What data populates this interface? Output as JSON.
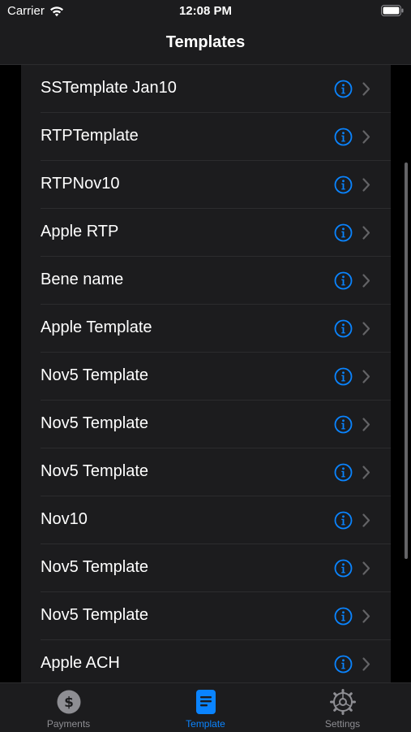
{
  "status_bar": {
    "carrier": "Carrier",
    "time": "12:08 PM"
  },
  "nav": {
    "title": "Templates"
  },
  "templates": [
    {
      "label": "SSTemplate Jan10"
    },
    {
      "label": "RTPTemplate"
    },
    {
      "label": "RTPNov10"
    },
    {
      "label": "Apple RTP"
    },
    {
      "label": "Bene name"
    },
    {
      "label": "Apple Template"
    },
    {
      "label": "Nov5 Template"
    },
    {
      "label": "Nov5 Template"
    },
    {
      "label": "Nov5 Template"
    },
    {
      "label": "Nov10"
    },
    {
      "label": "Nov5 Template"
    },
    {
      "label": "Nov5 Template"
    },
    {
      "label": "Apple ACH"
    }
  ],
  "row_icons": {
    "info": "info-circle-icon",
    "disclosure": "chevron-right-icon"
  },
  "tabs": [
    {
      "label": "Payments",
      "icon": "dollar-circle-icon",
      "active": false
    },
    {
      "label": "Template",
      "icon": "document-icon",
      "active": true
    },
    {
      "label": "Settings",
      "icon": "gear-icon",
      "active": false
    }
  ],
  "colors": {
    "accent": "#0a84ff",
    "background": "#000000",
    "surface": "#1c1c1e",
    "separator": "#2c2c2e",
    "inactive": "#8e8e93",
    "chevron": "#636366"
  }
}
